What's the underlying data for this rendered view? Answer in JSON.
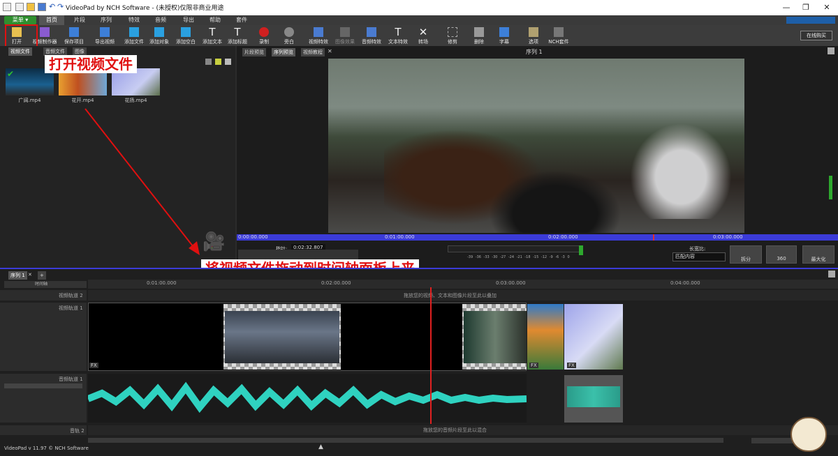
{
  "window": {
    "title": "VideoPad by NCH Software - (未授权)仅限非商业用途"
  },
  "menu": {
    "main": "菜单 ▾",
    "tabs": [
      "首页",
      "片段",
      "序列",
      "特效",
      "音频",
      "导出",
      "帮助",
      "套件"
    ]
  },
  "toolbar": {
    "items": [
      {
        "label": "打开",
        "icon": "folder-open-icon"
      },
      {
        "label": "视频制作器",
        "icon": "wand-icon"
      },
      {
        "label": "保存项目",
        "icon": "save-icon"
      },
      {
        "label": "导出视频",
        "icon": "export-icon"
      },
      {
        "label": "添加文件",
        "icon": "add-file-icon"
      },
      {
        "label": "添加对象",
        "icon": "add-object-icon"
      },
      {
        "label": "添加空白",
        "icon": "add-blank-icon"
      },
      {
        "label": "添加文本",
        "icon": "add-text-icon"
      },
      {
        "label": "添加标题",
        "icon": "add-title-icon"
      },
      {
        "label": "录制",
        "icon": "record-icon"
      },
      {
        "label": "旁白",
        "icon": "microphone-icon"
      },
      {
        "label": "视频特效",
        "icon": "video-fx-icon"
      },
      {
        "label": "图像效果",
        "icon": "image-fx-icon"
      },
      {
        "label": "音频特效",
        "icon": "audio-fx-icon"
      },
      {
        "label": "文本特效",
        "icon": "text-fx-icon"
      },
      {
        "label": "转场",
        "icon": "transition-icon"
      },
      {
        "label": "修剪",
        "icon": "crop-icon"
      },
      {
        "label": "删除",
        "icon": "trash-icon"
      },
      {
        "label": "字幕",
        "icon": "subtitle-icon"
      },
      {
        "label": "选项",
        "icon": "options-icon"
      },
      {
        "label": "NCH套件",
        "icon": "suite-icon"
      }
    ],
    "buy": "在线购买"
  },
  "bins": {
    "tabs": [
      "视频文件",
      "音频文件",
      "图像"
    ],
    "files": [
      {
        "name": "广阔.mp4"
      },
      {
        "name": "花开.mp4"
      },
      {
        "name": "花扬.mp4"
      }
    ]
  },
  "preview": {
    "tabs": [
      "片段预览",
      "序列预览",
      "视频教程"
    ],
    "sequence_title": "序列 1",
    "ruler": [
      "0:00:00.000",
      "0:01:00.000",
      "0:02:00.000",
      "0:03:00.000"
    ],
    "playhead_label": "指针:",
    "playhead_time": "0:02:32.807",
    "meter_ticks": [
      "-39",
      "-36",
      "-33",
      "-30",
      "-27",
      "-24",
      "-21",
      "-18",
      "-15",
      "-12",
      "-9",
      "-6",
      "-3",
      "0"
    ],
    "aspect_label": "长宽比:",
    "aspect_value": "匹配内容",
    "split": "拆分",
    "btn360": "360",
    "maximize": "最大化"
  },
  "annotations": {
    "open": "打开视频文件",
    "drag": "将视频文件拖动到时间轴面板上来"
  },
  "timeline": {
    "tabs": [
      "序列 1"
    ],
    "add_tab": "+",
    "mode": "时间轴",
    "ruler": [
      "0:00:00.000",
      "0:01:00.000",
      "0:02:00.000",
      "0:03:00.000",
      "0:04:00.000"
    ],
    "tracks": {
      "video2": "视频轨道 2",
      "video1": "视频轨道 1",
      "audio1": "音频轨道 1",
      "audio2": "音轨 2"
    },
    "video_drop_hint": "拖放您的视频、文本和图像片段至此以叠加",
    "audio_drop_hint": "拖放您的音频片段至此以混合",
    "fx": "FX"
  },
  "status": {
    "version": "VideoPad v 11.97 © NCH Software"
  }
}
